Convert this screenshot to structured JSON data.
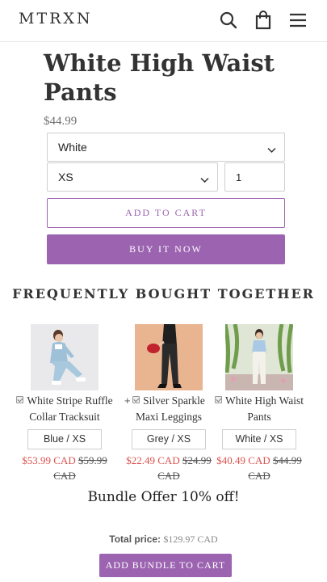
{
  "header": {
    "logo": "MTRXN",
    "icons": [
      "search-icon",
      "cart-icon",
      "menu-icon"
    ]
  },
  "product": {
    "title": "White High Waist Pants",
    "price": "$44.99",
    "color_value": "White",
    "size_value": "XS",
    "quantity": "1",
    "add_to_cart_label": "ADD TO CART",
    "buy_now_label": "BUY IT NOW"
  },
  "bundle": {
    "heading": "FREQUENTLY BOUGHT TOGETHER",
    "items": [
      {
        "name": "White Stripe Ruffle Collar Tracksuit",
        "variant": "Blue / XS",
        "price": "$53.99 CAD",
        "compare_price": "$59.99 CAD",
        "checked": true
      },
      {
        "name": "Silver Sparkle Maxi Leggings",
        "variant": "Grey / XS",
        "price": "$22.49 CAD",
        "compare_price": "$24.99 CAD",
        "checked": true
      },
      {
        "name": "White High Waist Pants",
        "variant": "White / XS",
        "price": "$40.49 CAD",
        "compare_price": "$44.99 CAD",
        "checked": true
      }
    ],
    "plus": "+",
    "offer": "Bundle Offer 10% off!",
    "total_label": "Total price:",
    "total_value": "$129.97 CAD",
    "add_bundle_label": "ADD BUNDLE TO CART"
  },
  "colors": {
    "accent": "#9b63b0",
    "sale_price": "#d9534f"
  }
}
